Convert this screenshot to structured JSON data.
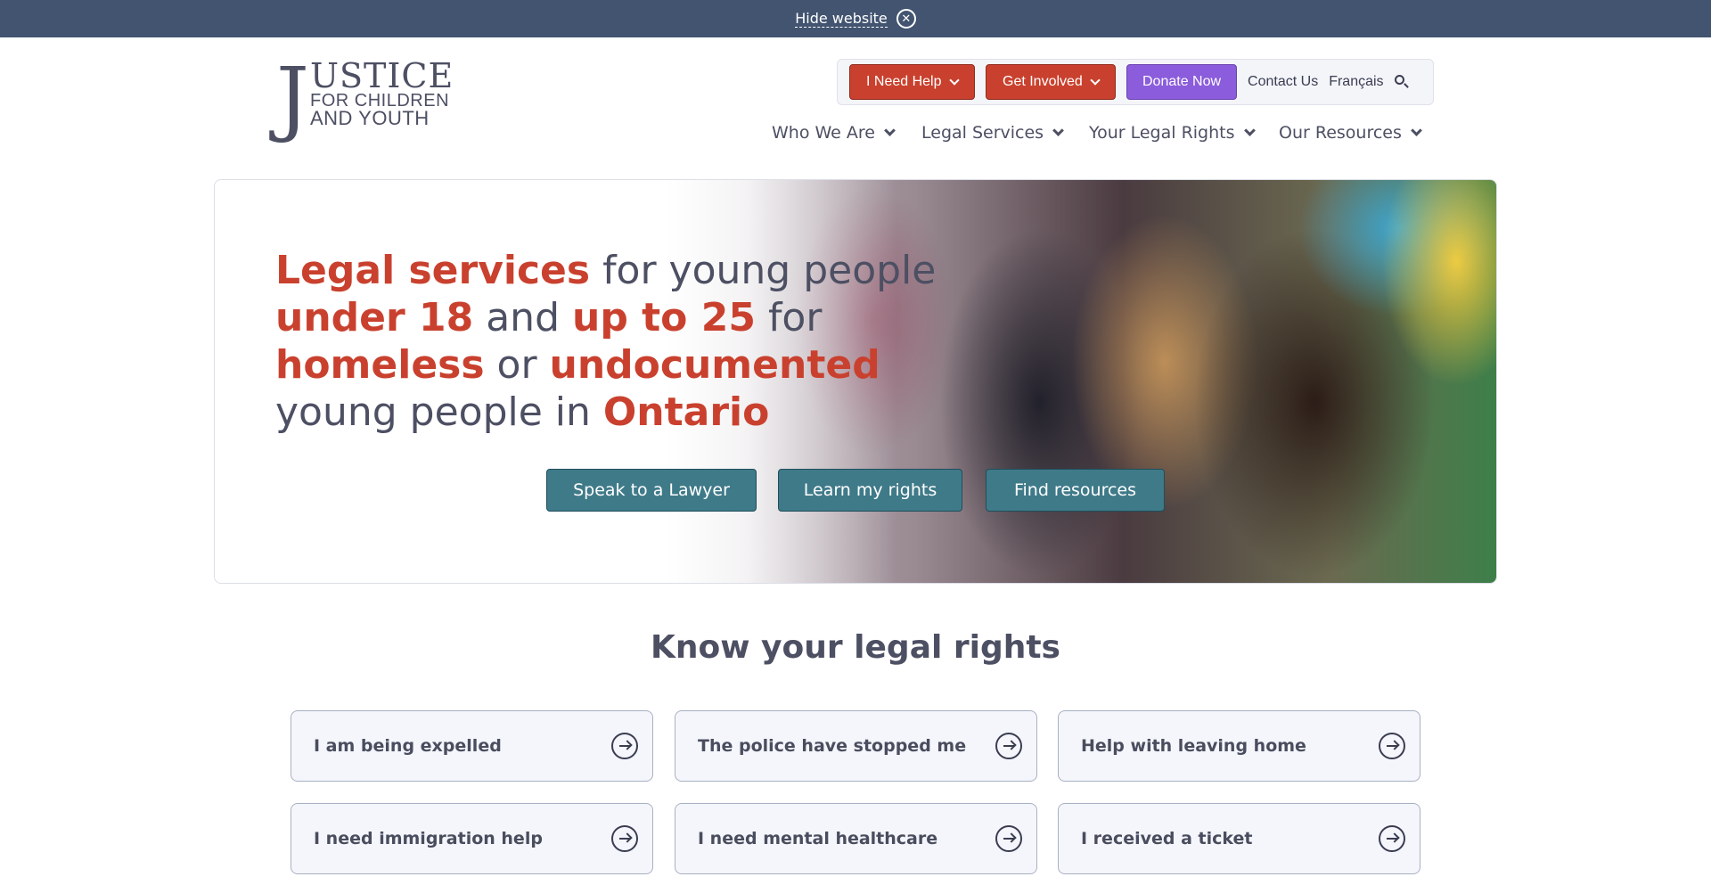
{
  "banner": {
    "hide_label": "Hide website"
  },
  "logo": {
    "line1": "USTICE",
    "line2": "FOR CHILDREN",
    "line3": "AND YOUTH",
    "initial": "J"
  },
  "utility_nav": {
    "need_help": "I Need Help",
    "get_involved": "Get Involved",
    "donate": "Donate Now",
    "contact": "Contact Us",
    "language": "Français"
  },
  "main_nav": [
    "Who We Are",
    "Legal Services",
    "Your Legal Rights",
    "Our Resources"
  ],
  "hero": {
    "line1_hl": "Legal services",
    "line1_rest": " for young people",
    "line2_hl1": "under 18",
    "line2_mid": " and ",
    "line2_hl2": "up to 25",
    "line2_rest": " for",
    "line3_hl1": "homeless",
    "line3_mid": " or ",
    "line3_hl2": "undocumented",
    "line4_rest": "young people in ",
    "line4_hl": "Ontario",
    "cta": [
      "Speak to a Lawyer",
      "Learn my rights",
      "Find resources"
    ]
  },
  "rights": {
    "title": "Know your legal rights",
    "cards": [
      "I am being expelled",
      "The police have stopped me",
      "Help with leaving home",
      "I need immigration help",
      "I need mental healthcare",
      "I received a ticket"
    ]
  },
  "colors": {
    "banner": "#425470",
    "accent_red": "#c9412e",
    "donate_purple": "#8b5cdb",
    "cta_teal": "#3f7a89",
    "text": "#4d4f63"
  }
}
